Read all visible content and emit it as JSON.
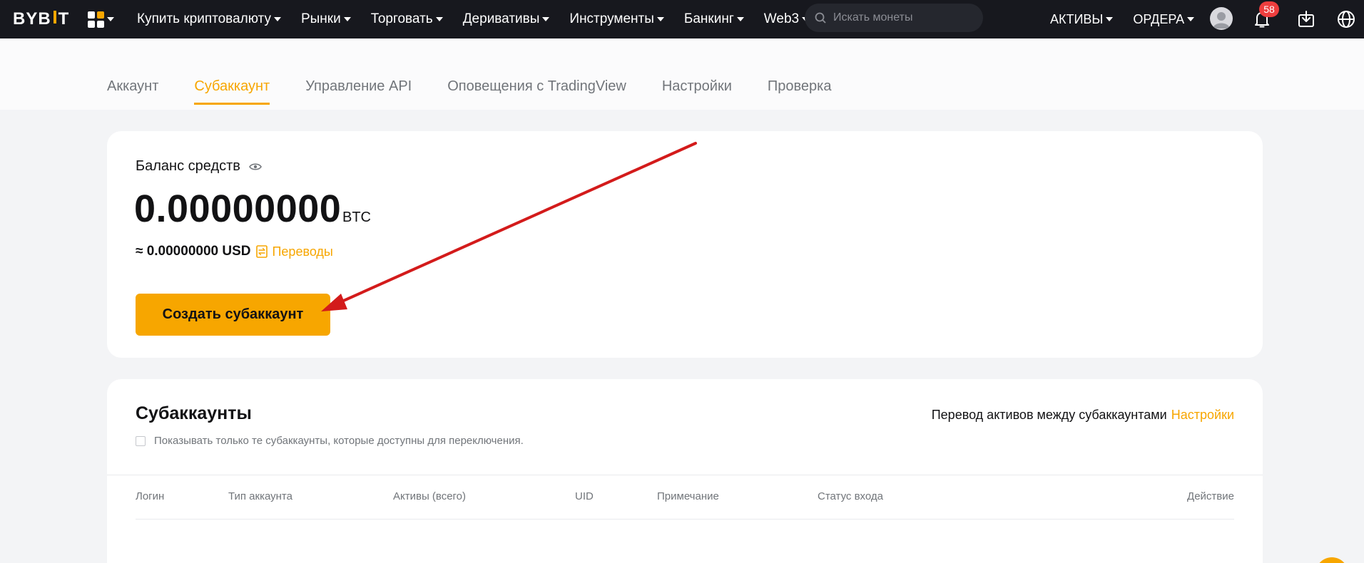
{
  "logo": {
    "text_left": "BYB",
    "text_right": "T"
  },
  "nav": {
    "items": [
      "Купить криптовалюту",
      "Рынки",
      "Торговать",
      "Деривативы",
      "Инструменты",
      "Банкинг",
      "Web3"
    ],
    "search_placeholder": "Искать монеты",
    "right": [
      "АКТИВЫ",
      "ОРДЕРА"
    ],
    "notification_count": "58"
  },
  "tabs": [
    "Аккаунт",
    "Субаккаунт",
    "Управление API",
    "Оповещения с TradingView",
    "Настройки",
    "Проверка"
  ],
  "active_tab": 1,
  "balance": {
    "label": "Баланс средств",
    "value": "0.00000000",
    "unit": "BTC",
    "usd": "≈ 0.00000000 USD",
    "transfer_label": "Переводы",
    "create_button": "Создать субаккаунт"
  },
  "subaccounts": {
    "title": "Субаккаунты",
    "filter_label": "Показывать только те субаккаунты, которые доступны для переключения.",
    "transfer_text": "Перевод активов между субаккаунтами",
    "settings_link": "Настройки",
    "columns": [
      "Логин",
      "Тип аккаунта",
      "Активы (всего)",
      "UID",
      "Примечание",
      "Статус входа",
      "Действие"
    ]
  },
  "colors": {
    "accent": "#f7a600",
    "nav_bg": "#17181e",
    "badge": "#ee3e3e",
    "annotation_arrow": "#d31b1b"
  }
}
